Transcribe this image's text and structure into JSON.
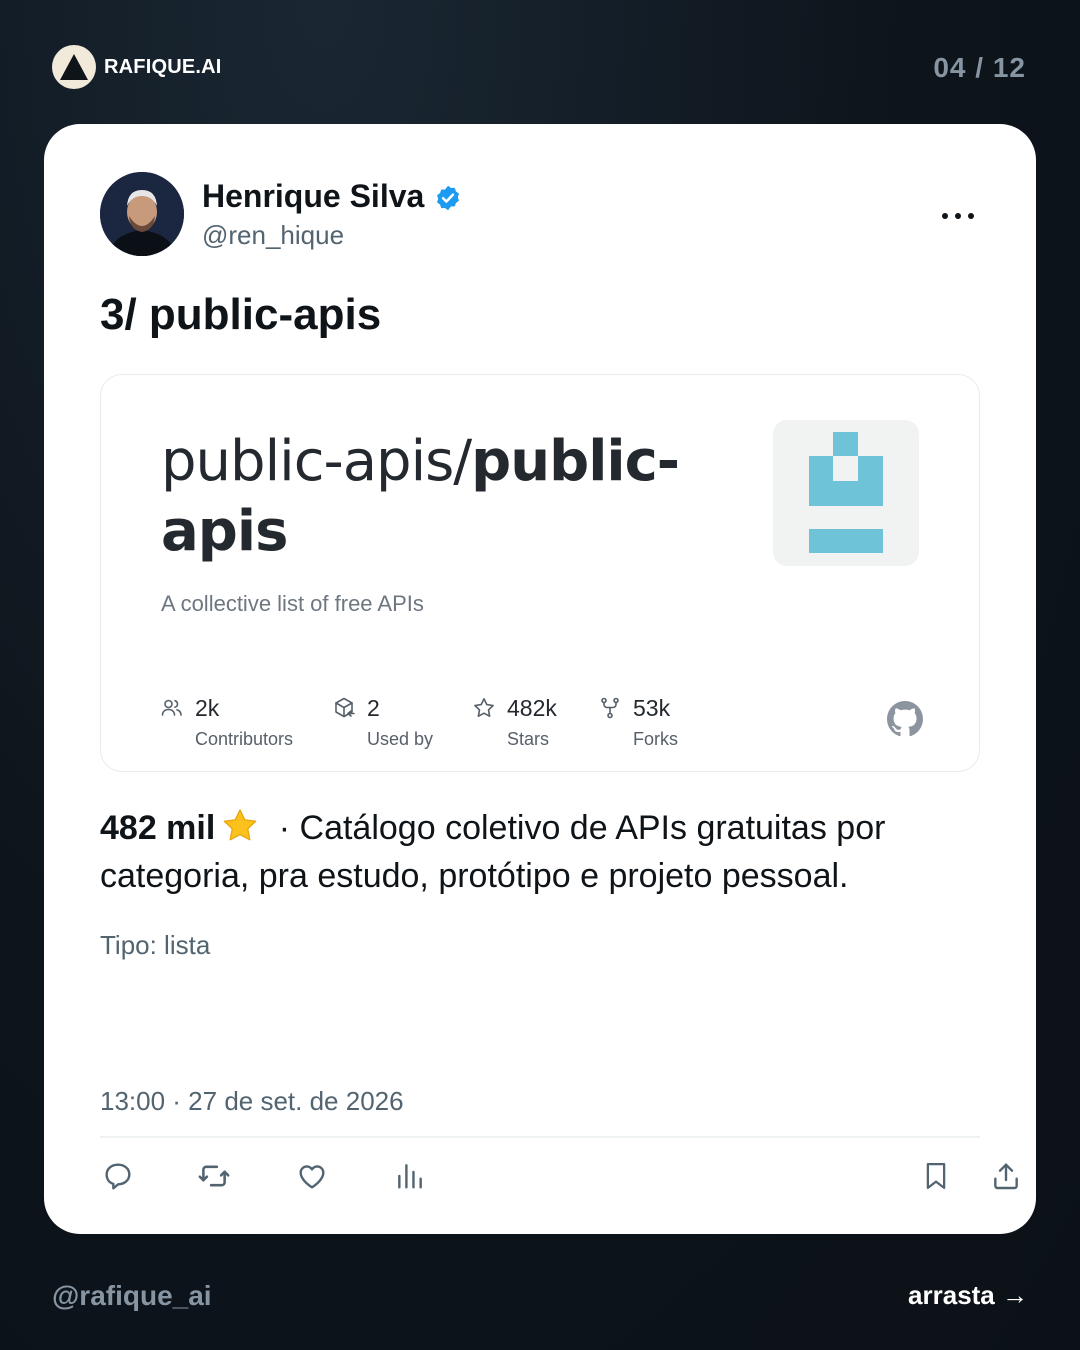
{
  "brand": {
    "name": "RAFIQUE.AI",
    "logo_icon": "triangle-logo-icon"
  },
  "page_counter": "04 / 12",
  "post": {
    "author_name": "Henrique Silva",
    "handle": "@ren_hique",
    "verified": true,
    "title": "3/ public-apis",
    "repo_card": {
      "owner": "public-apis/",
      "name": "public-apis",
      "description": "A collective list of free APIs",
      "stats": [
        {
          "value": "2k",
          "label": "Contributors",
          "icon": "people-icon"
        },
        {
          "value": "2",
          "label": "Used by",
          "icon": "package-icon"
        },
        {
          "value": "482k",
          "label": "Stars",
          "icon": "star-outline-icon"
        },
        {
          "value": "53k",
          "label": "Forks",
          "icon": "fork-icon"
        }
      ]
    },
    "body_strong": "482 mil",
    "body_rest": " · Catálogo coletivo de APIs gratuitas por categoria, pra estudo, protótipo e projeto pessoal.",
    "type_line": "Tipo: lista",
    "timestamp": "13:00 · 27 de set. de 2026"
  },
  "footer": {
    "handle": "@rafique_ai",
    "swipe": "arrasta →"
  },
  "colors": {
    "background": "#0d141b",
    "card": "#ffffff",
    "verified": "#1d9bf0",
    "repo_image": "#6fc3d9"
  }
}
